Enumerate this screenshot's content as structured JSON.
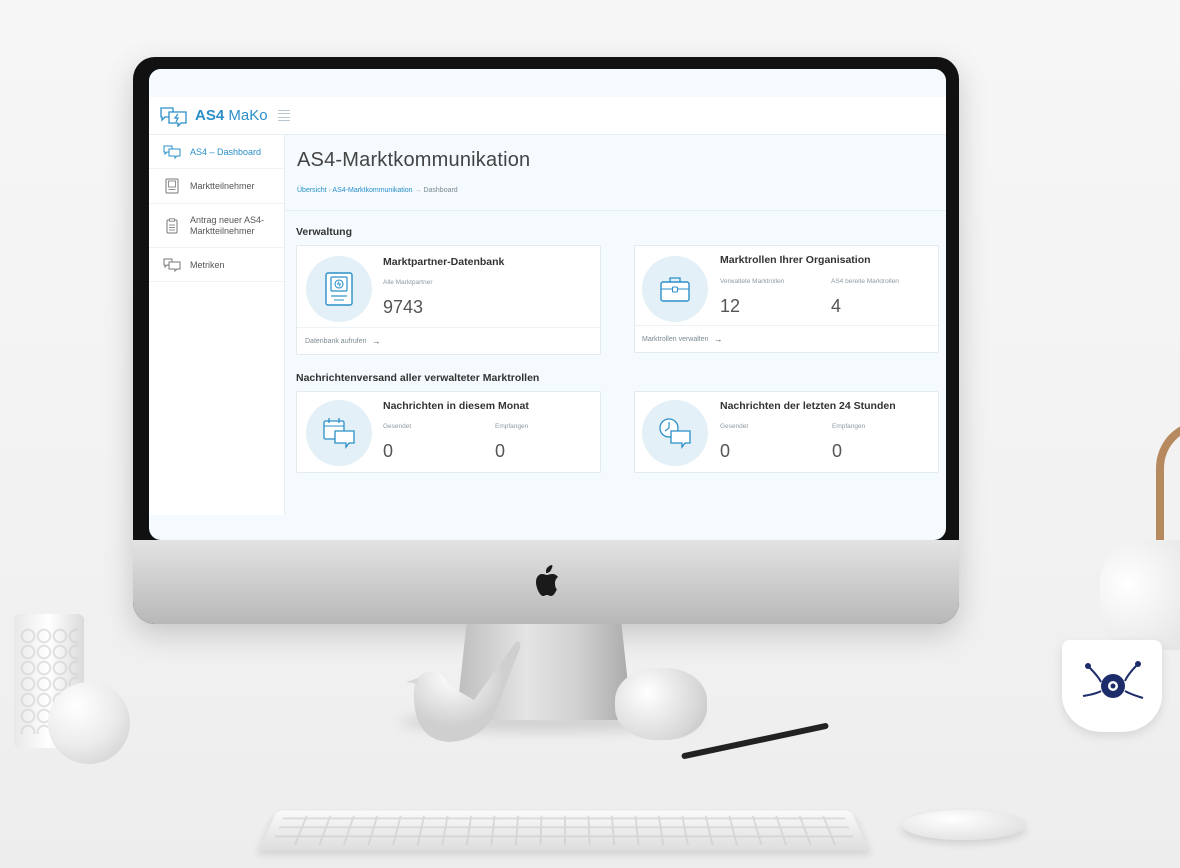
{
  "app": {
    "logo_bold": "AS4",
    "logo_rest": " MaKo"
  },
  "sidebar": {
    "items": [
      {
        "label": "AS4 – Dashboard",
        "icon": "chat-bubbles-icon"
      },
      {
        "label": "Marktteilnehmer",
        "icon": "id-card-icon"
      },
      {
        "label_line1": "Antrag neuer AS4-",
        "label_line2": "Marktteilnehmer",
        "icon": "clipboard-icon"
      },
      {
        "label": "Metriken",
        "icon": "chat-bubbles-icon"
      }
    ]
  },
  "page": {
    "title": "AS4-Marktkommunikation",
    "breadcrumb": {
      "link1": "Übersicht",
      "sep1": " › ",
      "link2": "AS4-Marktkommunikation",
      "sep2": " → ",
      "current": "Dashboard"
    }
  },
  "sections": {
    "verwaltung": "Verwaltung",
    "nachrichten": "Nachrichtenversand aller verwalteter Marktrollen"
  },
  "cards": {
    "marktpartner": {
      "title": "Marktpartner-Datenbank",
      "label": "Alle Marktpartner",
      "value": "9743",
      "footer": "Datenbank aufrufen",
      "arrow": "→"
    },
    "marktrollen": {
      "title": "Marktrollen Ihrer Organisation",
      "label1": "Verwaltete Marktrollen",
      "value1": "12",
      "label2": "AS4 bereite Marktrollen",
      "value2": "4",
      "footer": "Marktrollen verwalten",
      "arrow": "→"
    },
    "monat": {
      "title": "Nachrichten in diesem Monat",
      "label1": "Gesendet",
      "value1": "0",
      "label2": "Empfangen",
      "value2": "0"
    },
    "stunden": {
      "title": "Nachrichten der letzten 24 Stunden",
      "label1": "Gesendet",
      "value1": "0",
      "label2": "Empfangen",
      "value2": "0"
    }
  },
  "colors": {
    "accent": "#2a8fc8",
    "icon_circle": "#e3f0f7",
    "screen_bg": "#f4fafd"
  }
}
